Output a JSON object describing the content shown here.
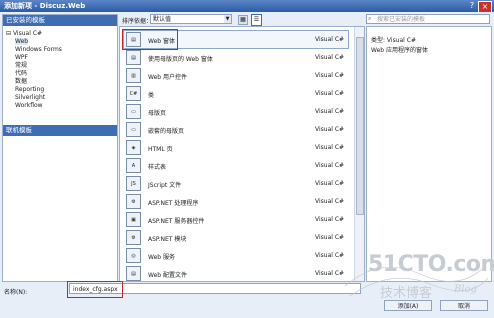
{
  "window": {
    "title": "添加新项 - Discuz.Web",
    "help": "?",
    "close": "×"
  },
  "left_panel": {
    "installed_header": "已安装的模板",
    "tree": [
      "Visual C#",
      "Web",
      "Windows Forms",
      "WPF",
      "常规",
      "代码",
      "数据",
      "Reporting",
      "Silverlight",
      "Workflow"
    ],
    "online_header": "联机模板"
  },
  "toolbar": {
    "sort_label": "排序依据：",
    "sort_value": "默认值",
    "search_placeholder": "搜索已安装的模板"
  },
  "templates": [
    {
      "name": "Web 窗体",
      "type": "Visual C#"
    },
    {
      "name": "使用母版页的 Web 窗体",
      "type": "Visual C#"
    },
    {
      "name": "Web 用户控件",
      "type": "Visual C#"
    },
    {
      "name": "类",
      "type": "Visual C#"
    },
    {
      "name": "母版页",
      "type": "Visual C#"
    },
    {
      "name": "嵌套的母版页",
      "type": "Visual C#"
    },
    {
      "name": "HTML 页",
      "type": "Visual C#"
    },
    {
      "name": "样式表",
      "type": "Visual C#"
    },
    {
      "name": "JScript 文件",
      "type": "Visual C#"
    },
    {
      "name": "ASP.NET 处理程序",
      "type": "Visual C#"
    },
    {
      "name": "ASP.NET 服务器控件",
      "type": "Visual C#"
    },
    {
      "name": "ASP.NET 模块",
      "type": "Visual C#"
    },
    {
      "name": "Web 服务",
      "type": "Visual C#"
    },
    {
      "name": "Web 配置文件",
      "type": "Visual C#"
    }
  ],
  "details": {
    "type_line": "类型: Visual C#",
    "description": "Web 应用程序的窗体"
  },
  "bottom": {
    "name_label": "名称(N):",
    "name_value": "index_cfg.aspx",
    "add_button": "添加(A)",
    "cancel_button": "取消"
  },
  "watermark": {
    "site": "51CTO.com",
    "tagline": "技术博客",
    "blog": "Blog"
  },
  "colors": {
    "title_bar": "#2c5aa5",
    "selection": "#3f6db3",
    "annotation_red": "#c0242a"
  }
}
